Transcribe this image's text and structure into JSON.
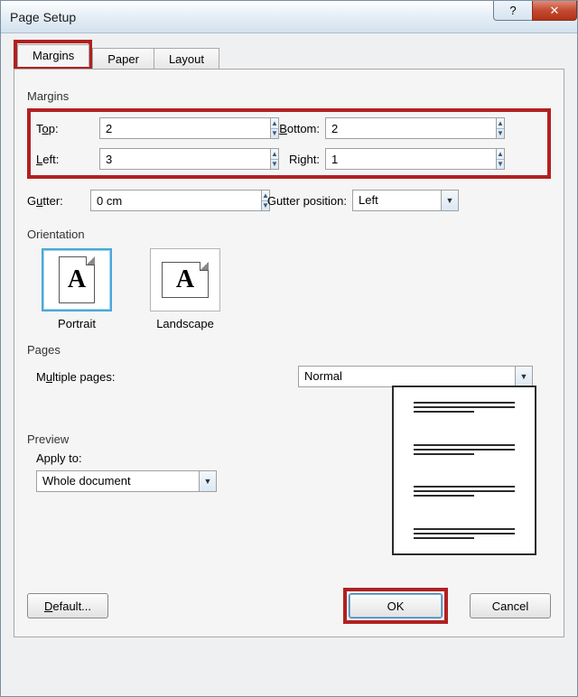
{
  "window": {
    "title": "Page Setup"
  },
  "tabs": {
    "margins": "Margins",
    "paper": "Paper",
    "layout": "Layout"
  },
  "margins": {
    "section_label": "Margins",
    "top_label_pre": "T",
    "top_label_mn": "o",
    "top_label_post": "p:",
    "top_value": "2",
    "bottom_label_pre": "",
    "bottom_label_mn": "B",
    "bottom_label_post": "ottom:",
    "bottom_value": "2",
    "left_label_pre": "",
    "left_label_mn": "L",
    "left_label_post": "eft:",
    "left_value": "3",
    "right_label_pre": "Ri",
    "right_label_mn": "g",
    "right_label_post": "ht:",
    "right_value": "1",
    "gutter_label_pre": "G",
    "gutter_label_mn": "u",
    "gutter_label_post": "tter:",
    "gutter_value": "0 cm",
    "gutter_pos_label_pre": "Gutter ",
    "gutter_pos_label_post": "position:",
    "gutter_pos_value": "Left"
  },
  "orientation": {
    "section_label": "Orientation",
    "glyph": "A",
    "portrait": "Portrait",
    "landscape": "Landscape"
  },
  "pages": {
    "section_label": "Pages",
    "multiple_pre": "M",
    "multiple_mn": "u",
    "multiple_post": "ltiple pages:",
    "value": "Normal"
  },
  "preview": {
    "section_label": "Preview",
    "apply_label": "Apply to:",
    "apply_value": "Whole document"
  },
  "buttons": {
    "default_pre": "",
    "default_mn": "D",
    "default_post": "efault...",
    "ok": "OK",
    "cancel": "Cancel"
  }
}
